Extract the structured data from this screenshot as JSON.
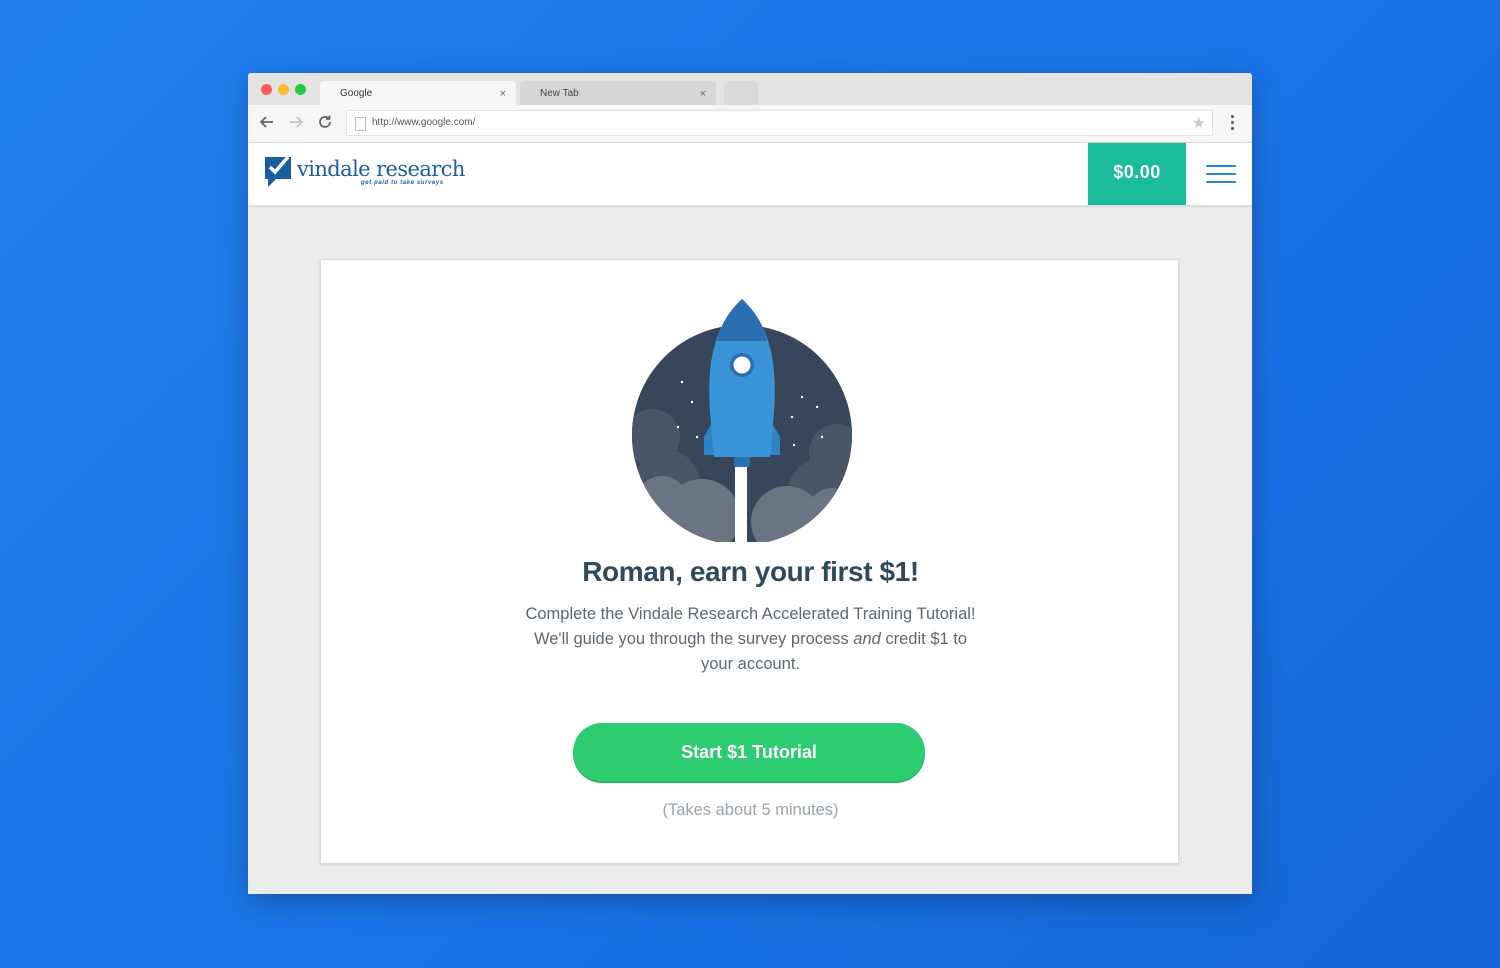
{
  "browser": {
    "tabs": [
      {
        "title": "Google",
        "active": true
      },
      {
        "title": "New Tab",
        "active": false
      }
    ],
    "close_glyph": "×",
    "url": "http://www.google.com/"
  },
  "header": {
    "logo_text": "vindale research",
    "logo_tagline": "get paid to take surveys",
    "balance": "$0.00",
    "brand_color": "#1a5e9e",
    "balance_color": "#1bbc9b"
  },
  "card": {
    "headline": "Roman, earn your first $1!",
    "description_part1": "Complete the Vindale Research Accelerated Training Tutorial! We'll guide you through the survey process ",
    "description_emphasis": "and",
    "description_part2": " credit $1 to your account.",
    "cta_label": "Start $1 Tutorial",
    "cta_color": "#2ecc71",
    "duration_note": "(Takes about 5 minutes)"
  },
  "icons": [
    "back-arrow-icon",
    "forward-arrow-icon",
    "reload-icon",
    "page-icon",
    "star-icon",
    "kebab-menu-icon",
    "hamburger-menu-icon",
    "rocket-illustration"
  ]
}
